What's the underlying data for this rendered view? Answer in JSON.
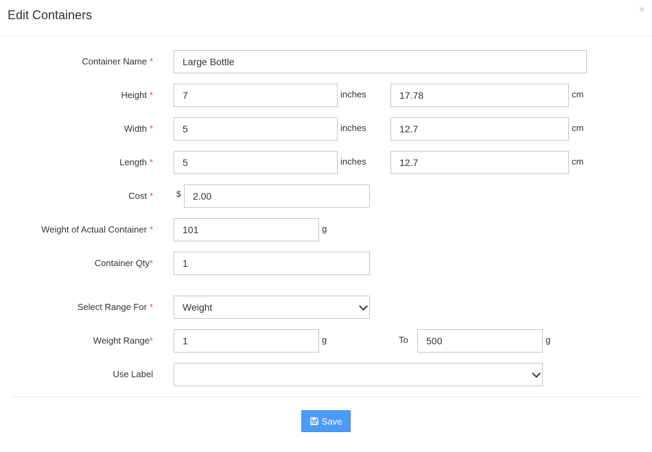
{
  "modal": {
    "title": "Edit Containers",
    "close_glyph": "×"
  },
  "form": {
    "required_mark": "*",
    "container_name": {
      "label": "Container Name",
      "value": "Large Bottle"
    },
    "height": {
      "label": "Height",
      "inches": "7",
      "cm": "17.78",
      "inches_unit": "inches",
      "cm_unit": "cm"
    },
    "width": {
      "label": "Width",
      "inches": "5",
      "cm": "12.7",
      "inches_unit": "inches",
      "cm_unit": "cm"
    },
    "length": {
      "label": "Length",
      "inches": "5",
      "cm": "12.7",
      "inches_unit": "inches",
      "cm_unit": "cm"
    },
    "cost": {
      "label": "Cost",
      "currency": "$",
      "value": "2.00"
    },
    "weight_actual": {
      "label": "Weight of Actual Container",
      "value": "101",
      "unit": "g"
    },
    "container_qty": {
      "label": "Container Qty",
      "value": "1"
    },
    "select_range_for": {
      "label": "Select Range For",
      "selected": "Weight"
    },
    "weight_range": {
      "label": "Weight Range",
      "from": "1",
      "from_unit": "g",
      "to_label": "To",
      "to": "500",
      "to_unit": "g"
    },
    "use_label": {
      "label": "Use Label",
      "selected": ""
    }
  },
  "footer": {
    "save_label": "Save",
    "save_icon": "floppy-disk-icon",
    "accent_color": "#4c9cf7"
  }
}
